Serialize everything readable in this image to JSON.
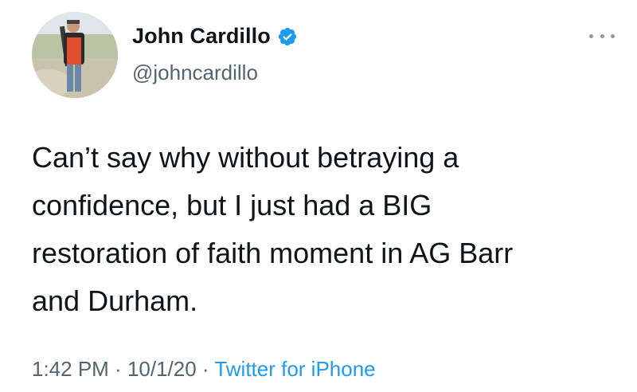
{
  "tweet": {
    "author": {
      "display_name": "John Cardillo",
      "handle": "@johncardillo",
      "verified": true
    },
    "text": "Can’t say why without betraying a\nconfidence, but I just had a BIG\nrestoration of faith moment in AG Barr\nand Durham.",
    "time": "1:42 PM",
    "separator": " · ",
    "date": "10/1/20",
    "source": "Twitter for iPhone"
  },
  "icons": {
    "verified": "verified-badge-icon",
    "more": "more-options-icon"
  },
  "colors": {
    "text_primary": "#0f1419",
    "text_secondary": "#536471",
    "accent": "#1d9bf0"
  }
}
